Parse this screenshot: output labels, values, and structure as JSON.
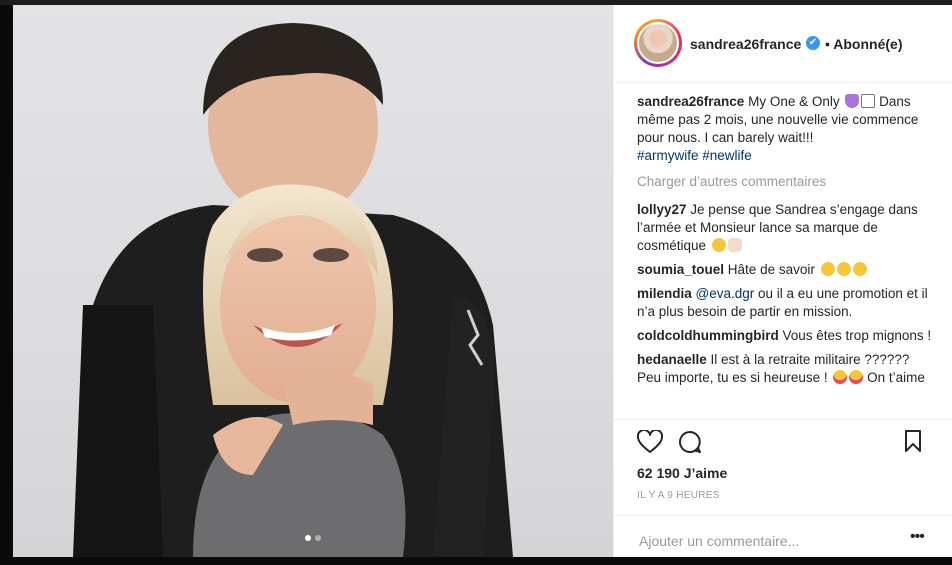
{
  "post": {
    "username": "sandrea26france",
    "follow_status": "• Abonné(e)",
    "caption_user": "sandrea26france",
    "caption_text": "My One & Only",
    "caption_line2": "Dans même pas 2 mois, une nouvelle vie commence pour nous. I can barely wait!!!",
    "hashtags": [
      "#armywife",
      "#newlife"
    ],
    "load_more": "Charger d’autres commentaires",
    "comments": [
      {
        "user": "lollyy27",
        "text": "Je pense que Sandrea s’engage dans l’armée et Monsieur lance sa marque de cosmétique"
      },
      {
        "user": "soumia_touel",
        "text": "Hâte de savoir"
      },
      {
        "user": "milendia",
        "mention": "@eva.dgr",
        "text": "ou il a eu une promotion et il n’a plus besoin de partir en mission."
      },
      {
        "user": "coldcoldhummingbird",
        "text": "Vous êtes trop mignons !"
      },
      {
        "user": "hedanaelle",
        "text": "Il est à la retraite militaire ?????? Peu importe, tu es si heureuse !",
        "tail": "On t’aime"
      }
    ],
    "likes": "62 190 J’aime",
    "time": "IL Y A 9 HEURES",
    "add_comment_placeholder": "Ajouter un commentaire...",
    "more_label": "•••"
  },
  "icons": {
    "like": "heart-outline-icon",
    "comment": "speech-bubble-icon",
    "save": "bookmark-icon",
    "verified": "verified-badge-icon"
  },
  "colors": {
    "link": "#003569",
    "verified": "#3897f0",
    "muted": "#999999"
  }
}
